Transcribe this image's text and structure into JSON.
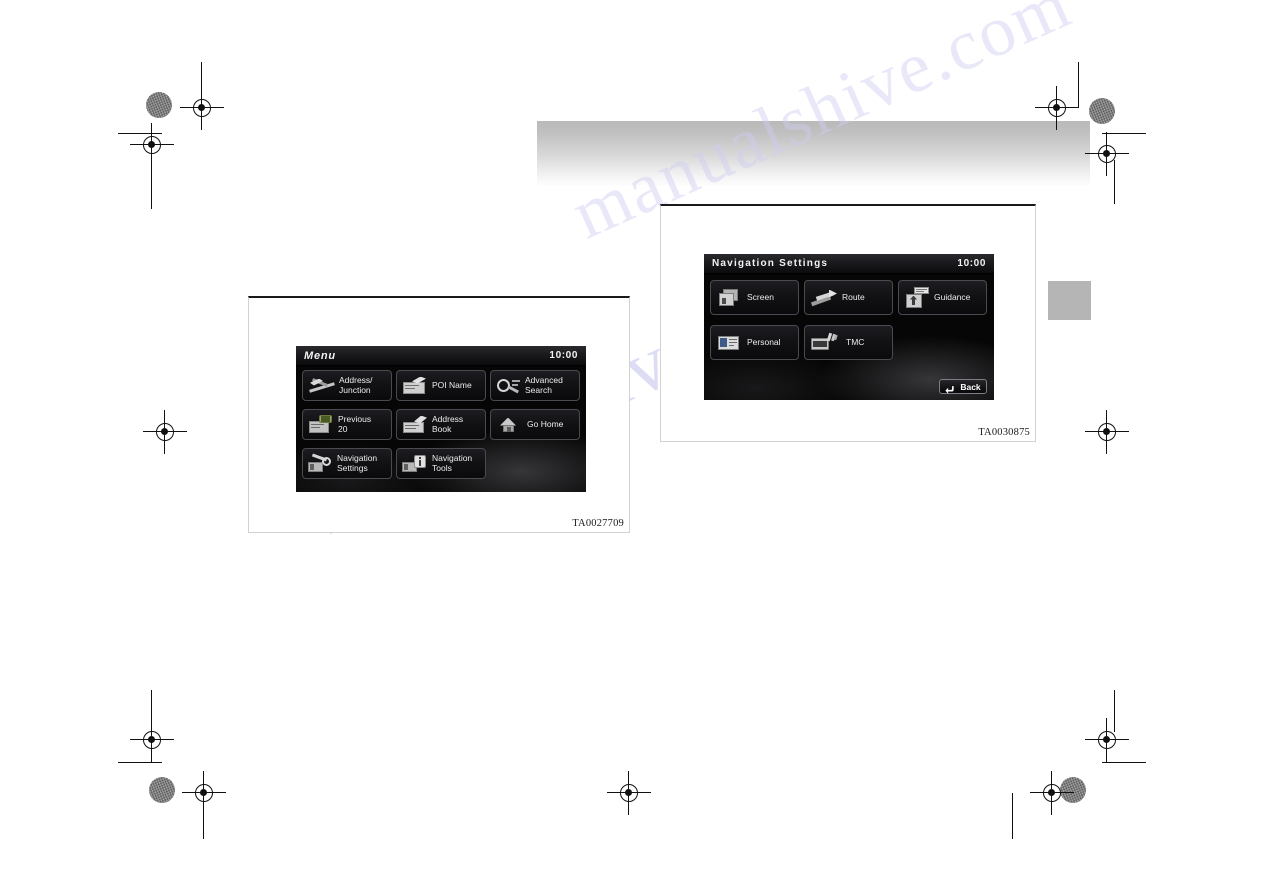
{
  "page": {
    "background_color": "#ffffff",
    "watermark_text": "manualshive",
    "watermark_text_2": "manualshive.com",
    "header_band_color": "#c0c0c0",
    "edge_tab_color": "#b5b5b5"
  },
  "figures": [
    {
      "id": "figure-menu",
      "code": "TA0027709",
      "screen": {
        "title": "Menu",
        "clock": "10:00",
        "background_color": "#050505",
        "buttons": [
          {
            "label": "Address/\nJunction",
            "icon": "road-junction-icon"
          },
          {
            "label": "POI Name",
            "icon": "poi-flag-icon"
          },
          {
            "label": "Advanced\nSearch",
            "icon": "magnifier-icon"
          },
          {
            "label": "Previous\n20",
            "icon": "previous-list-icon"
          },
          {
            "label": "Address\nBook",
            "icon": "address-book-icon"
          },
          {
            "label": "Go Home",
            "icon": "home-icon"
          },
          {
            "label": "Navigation\nSettings",
            "icon": "wrench-gear-icon"
          },
          {
            "label": "Navigation\nTools",
            "icon": "info-tools-icon"
          }
        ]
      }
    },
    {
      "id": "figure-navigation-settings",
      "code": "TA0030875",
      "screen": {
        "title": "Navigation Settings",
        "clock": "10:00",
        "background_color": "#050505",
        "buttons": [
          {
            "label": "Screen",
            "icon": "screen-stack-icon"
          },
          {
            "label": "Route",
            "icon": "route-arrow-icon"
          },
          {
            "label": "Guidance",
            "icon": "guidance-sign-icon"
          },
          {
            "label": "Personal",
            "icon": "id-card-icon"
          },
          {
            "label": "TMC",
            "icon": "tmc-broadcast-icon"
          }
        ],
        "back_button": {
          "label": "Back",
          "icon": "return-arrow-icon"
        }
      }
    }
  ]
}
